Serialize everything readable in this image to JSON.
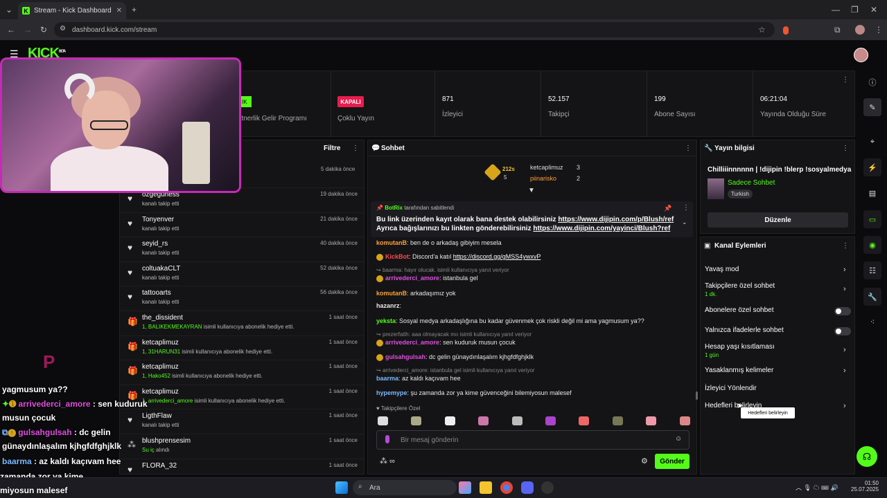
{
  "browser": {
    "tab_title": "Stream - Kick Dashboard",
    "url": "dashboard.kick.com/stream"
  },
  "app": {
    "logo": "KICK",
    "logo_badge": "BETA"
  },
  "stats": {
    "partner_badge": "IK",
    "partner_label": "rtnerlik Gelir Programı",
    "multistream_badge": "KAPALI",
    "multistream_label": "Çoklu Yayın",
    "viewers_value": "871",
    "viewers_label": "İzleyici",
    "followers_value": "52.157",
    "followers_label": "Takipçi",
    "subs_value": "199",
    "subs_label": "Abone Sayısı",
    "uptime_value": "06:21:04",
    "uptime_label": "Yayında Olduğu Süre"
  },
  "feed": {
    "filter_label": "Filtre",
    "first_time": "5 dakika önce",
    "rows": [
      {
        "name": "ozgeguness",
        "sub": "kanalı takip etti",
        "time": "19 dakika önce",
        "icon": "heart-icon"
      },
      {
        "name": "Tonyenver",
        "sub": "kanalı takip etti",
        "time": "21 dakika önce",
        "icon": "heart-icon"
      },
      {
        "name": "seyid_rs",
        "sub": "kanalı takip etti",
        "time": "40 dakika önce",
        "icon": "heart-icon"
      },
      {
        "name": "coltuakaCLT",
        "sub": "kanalı takip etti",
        "time": "52 dakika önce",
        "icon": "heart-icon"
      },
      {
        "name": "tattooarts",
        "sub": "kanalı takip etti",
        "time": "56 dakika önce",
        "icon": "heart-icon"
      },
      {
        "name": "the_dissident",
        "sub_hl": "1, BALIKEKMEKAYRAN",
        "sub": " isimli kullanıcıya abonelik hediye etti.",
        "time": "1 saat önce",
        "icon": "gift-icon"
      },
      {
        "name": "ketcaplimuz",
        "sub_hl": "1, 31HARUN31",
        "sub": " isimli kullanıcıya abonelik hediye etti.",
        "time": "1 saat önce",
        "icon": "gift-icon"
      },
      {
        "name": "ketcaplimuz",
        "sub_hl": "1, Hako452",
        "sub": " isimli kullanıcıya abonelik hediye etti.",
        "time": "1 saat önce",
        "icon": "gift-icon"
      },
      {
        "name": "ketcaplimuz",
        "sub_hl": "1, arrivederci_amore",
        "sub": " isimli kullanıcıya abonelik hediye etti.",
        "time": "1 saat önce",
        "icon": "gift-icon"
      },
      {
        "name": "LigthFlaw",
        "sub": "kanalı takip etti",
        "time": "1 saat önce",
        "icon": "heart-icon"
      },
      {
        "name": "blushprensesim",
        "sub_hl": "Su iç",
        "sub": " alındı",
        "time": "1 saat önce",
        "icon": "points-icon"
      },
      {
        "name": "FLORA_32",
        "sub": "",
        "time": "1 saat önce",
        "icon": "heart-icon"
      }
    ]
  },
  "chat": {
    "title": "Sohbet",
    "leader_count": "212s",
    "leader_sub": "5",
    "top1": "ketcaplimuz",
    "top1_count": "3",
    "top2": "piinarisko",
    "top2_count": "2",
    "pinned_by": "BotRix",
    "pinned_suffix": "tarafından sabitlendi",
    "pinned_line1": "Bu link üzerinden kayıt olarak bana destek olabilirsiniz ",
    "pinned_link1": "https://www.dijipin.com/p/Blush/ref",
    "pinned_line2": "Ayrıca bağışlarınızı bu linkten gönderebilirsiniz ",
    "pinned_link2": "https://www.dijipin.com/yayinci/Blush?ref",
    "messages": [
      {
        "user": "komutanB",
        "text": ": ben de o arkadaş gibiyim mesela"
      },
      {
        "user": "KickBot",
        "text": ": Discord'a katıl ",
        "link": "https://discord.gg/gMSS4ywxvP"
      },
      {
        "reply": "baarma: hayır olucak. isimli kullanıcıya yanıt veriyor"
      },
      {
        "user": "arrivederci_amore",
        "text": ": istanbula gel"
      },
      {
        "user": "komutanB",
        "text": ": arkadaşımız yok"
      },
      {
        "user": "hazanrz",
        "text": ":"
      },
      {
        "user": "yeksta",
        "text": ": Sosyal medya arkadaşlığına bu kadar güvenmek çok riskli değil mi ama yagmusum ya??"
      },
      {
        "reply": "prezerfatih: aaa olmayacak mıı isimli kullanıcıya yanıt veriyor"
      },
      {
        "user": "arrivederci_amore",
        "text": ": sen kuduruk musun çocuk"
      },
      {
        "user": "gulsahgulsah",
        "text": ": dc gelin günaydınlaşalım kjhgfdfghjklk"
      },
      {
        "reply": "arrivederci_amore: istanbula gel isimli kullanıcıya yanıt veriyor"
      },
      {
        "user": "baarma",
        "text": ": az kaldı kaçıvam hee"
      },
      {
        "user": "hypemype",
        "text": ": şu zamanda zor ya kime güvenceğini bilemiyosun malesef"
      }
    ],
    "followers_only": "Takipçilere Özel",
    "input_placeholder": "Bir mesaj gönderin",
    "send_label": "Gönder"
  },
  "stream_info": {
    "title": "Yayın bilgisi",
    "stream_title": "Chilliiinnnnnn | !dijipin !blerp !sosyalmedya",
    "category": "Sadece Sohbet",
    "language": "Turkish",
    "edit_label": "Düzenle"
  },
  "channel_actions": {
    "title": "Kanal Eylemleri",
    "items": [
      {
        "label": "Yavaş mod",
        "sub": ""
      },
      {
        "label": "Takipçilere özel sohbet",
        "sub": "1 dk."
      },
      {
        "label": "Abonelere özel sohbet",
        "sub": ""
      },
      {
        "label": "Yalnızca ifadelerle sohbet",
        "sub": ""
      },
      {
        "label": "Hesap yaşı kısıtlaması",
        "sub": "1 gün"
      },
      {
        "label": "Yasaklanmış kelimeler",
        "sub": ""
      },
      {
        "label": "İzleyici Yönlendir",
        "sub": ""
      },
      {
        "label": "Hedefleri belirleyin",
        "sub": ""
      }
    ],
    "tooltip": "Hedefleri belirleyin"
  },
  "overlay_chat": {
    "line1": "yagmusum ya??",
    "line2_user": "arrivederci_amore",
    "line2_text": " : sen kuduruk",
    "line3": "musun çocuk",
    "line4_user": "gulsahgulsah",
    "line4_text": " : dc gelin",
    "line5": "günaydınlaşalım kjhgfdfghjklk",
    "line6_user": "baarma",
    "line6_text": " : az kaldı kaçıvam hee",
    "line7": "zamanda zor ya kime",
    "line8": "miyosun malesef"
  },
  "taskbar": {
    "search": "Ara",
    "time": "01:50",
    "date": "25.07.2025"
  }
}
